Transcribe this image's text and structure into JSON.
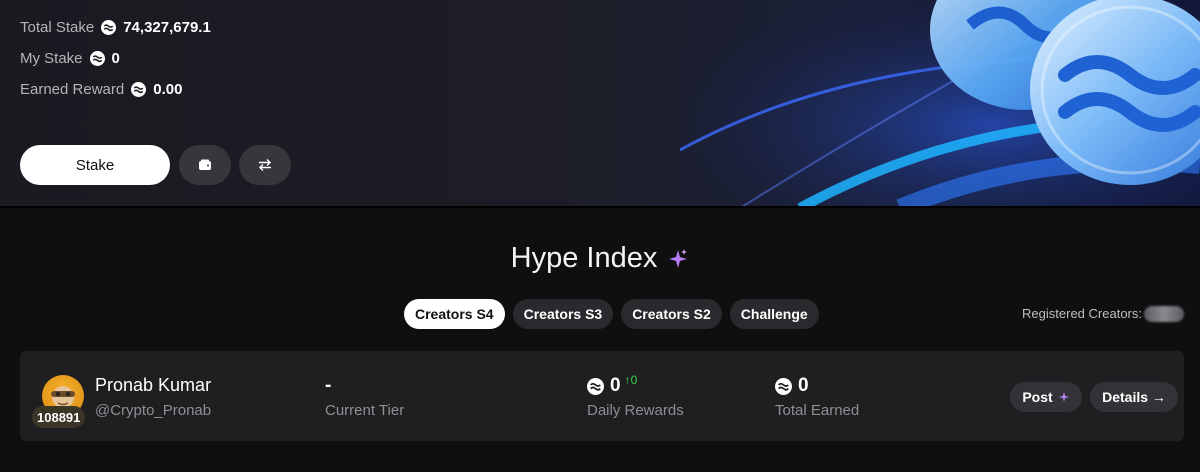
{
  "staking": {
    "total_stake_label": "Total Stake",
    "total_stake_value": "74,327,679.1",
    "my_stake_label": "My Stake",
    "my_stake_value": "0",
    "earned_reward_label": "Earned Reward",
    "earned_reward_value": "0.00",
    "stake_button": "Stake",
    "wallet_icon": "wallet-icon",
    "swap_icon": "swap-arrows-icon"
  },
  "hype_index": {
    "title": "Hype Index",
    "title_icon": "sparkle-icon",
    "tabs": [
      {
        "label": "Creators S4",
        "active": true
      },
      {
        "label": "Creators S3",
        "active": false
      },
      {
        "label": "Creators S2",
        "active": false
      },
      {
        "label": "Challenge",
        "active": false
      }
    ],
    "registered_label": "Registered Creators:"
  },
  "creator_card": {
    "name": "Pronab Kumar",
    "handle": "@Crypto_Pronab",
    "badge": "108891",
    "tier_value": "-",
    "tier_label": "Current Tier",
    "daily_rewards_value": "0",
    "daily_rewards_change": "↑0",
    "daily_rewards_label": "Daily Rewards",
    "total_earned_value": "0",
    "total_earned_label": "Total Earned",
    "post_button": "Post",
    "details_button": "Details →"
  },
  "colors": {
    "accent_sparkle": "#b67cf5",
    "positive": "#32d74b",
    "coin_blue": "#3b82f6"
  }
}
